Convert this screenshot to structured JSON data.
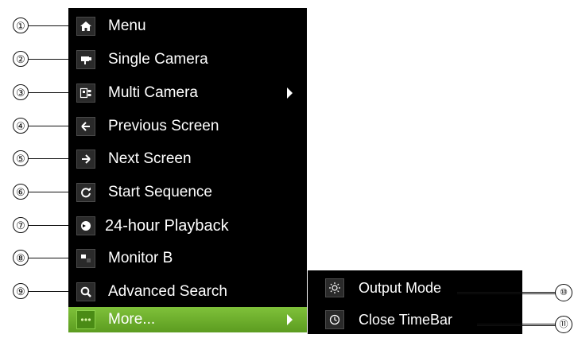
{
  "menu": {
    "items": [
      {
        "label": "Menu",
        "icon": "home-icon"
      },
      {
        "label": "Single Camera",
        "icon": "camera-icon"
      },
      {
        "label": "Multi Camera",
        "icon": "multi-camera-icon",
        "has_submenu": true
      },
      {
        "label": "Previous Screen",
        "icon": "arrow-left-icon"
      },
      {
        "label": "Next Screen",
        "icon": "arrow-right-icon"
      },
      {
        "label": "Start Sequence",
        "icon": "refresh-icon"
      },
      {
        "label": "24-hour Playback",
        "icon": "playback-icon"
      },
      {
        "label": "Monitor B",
        "icon": "monitor-icon"
      },
      {
        "label": "Advanced Search",
        "icon": "search-icon"
      },
      {
        "label": "More...",
        "icon": "more-icon",
        "has_submenu": true,
        "highlighted": true
      }
    ]
  },
  "submenu": {
    "items": [
      {
        "label": "Output Mode",
        "icon": "brightness-icon"
      },
      {
        "label": "Close TimeBar",
        "icon": "clock-icon"
      }
    ]
  },
  "callouts": [
    "①",
    "②",
    "③",
    "④",
    "⑤",
    "⑥",
    "⑦",
    "⑧",
    "⑨",
    "⑩",
    "⑪"
  ],
  "colors": {
    "menu_bg": "#000000",
    "highlight": "#6fae2c",
    "text": "#ffffff"
  }
}
